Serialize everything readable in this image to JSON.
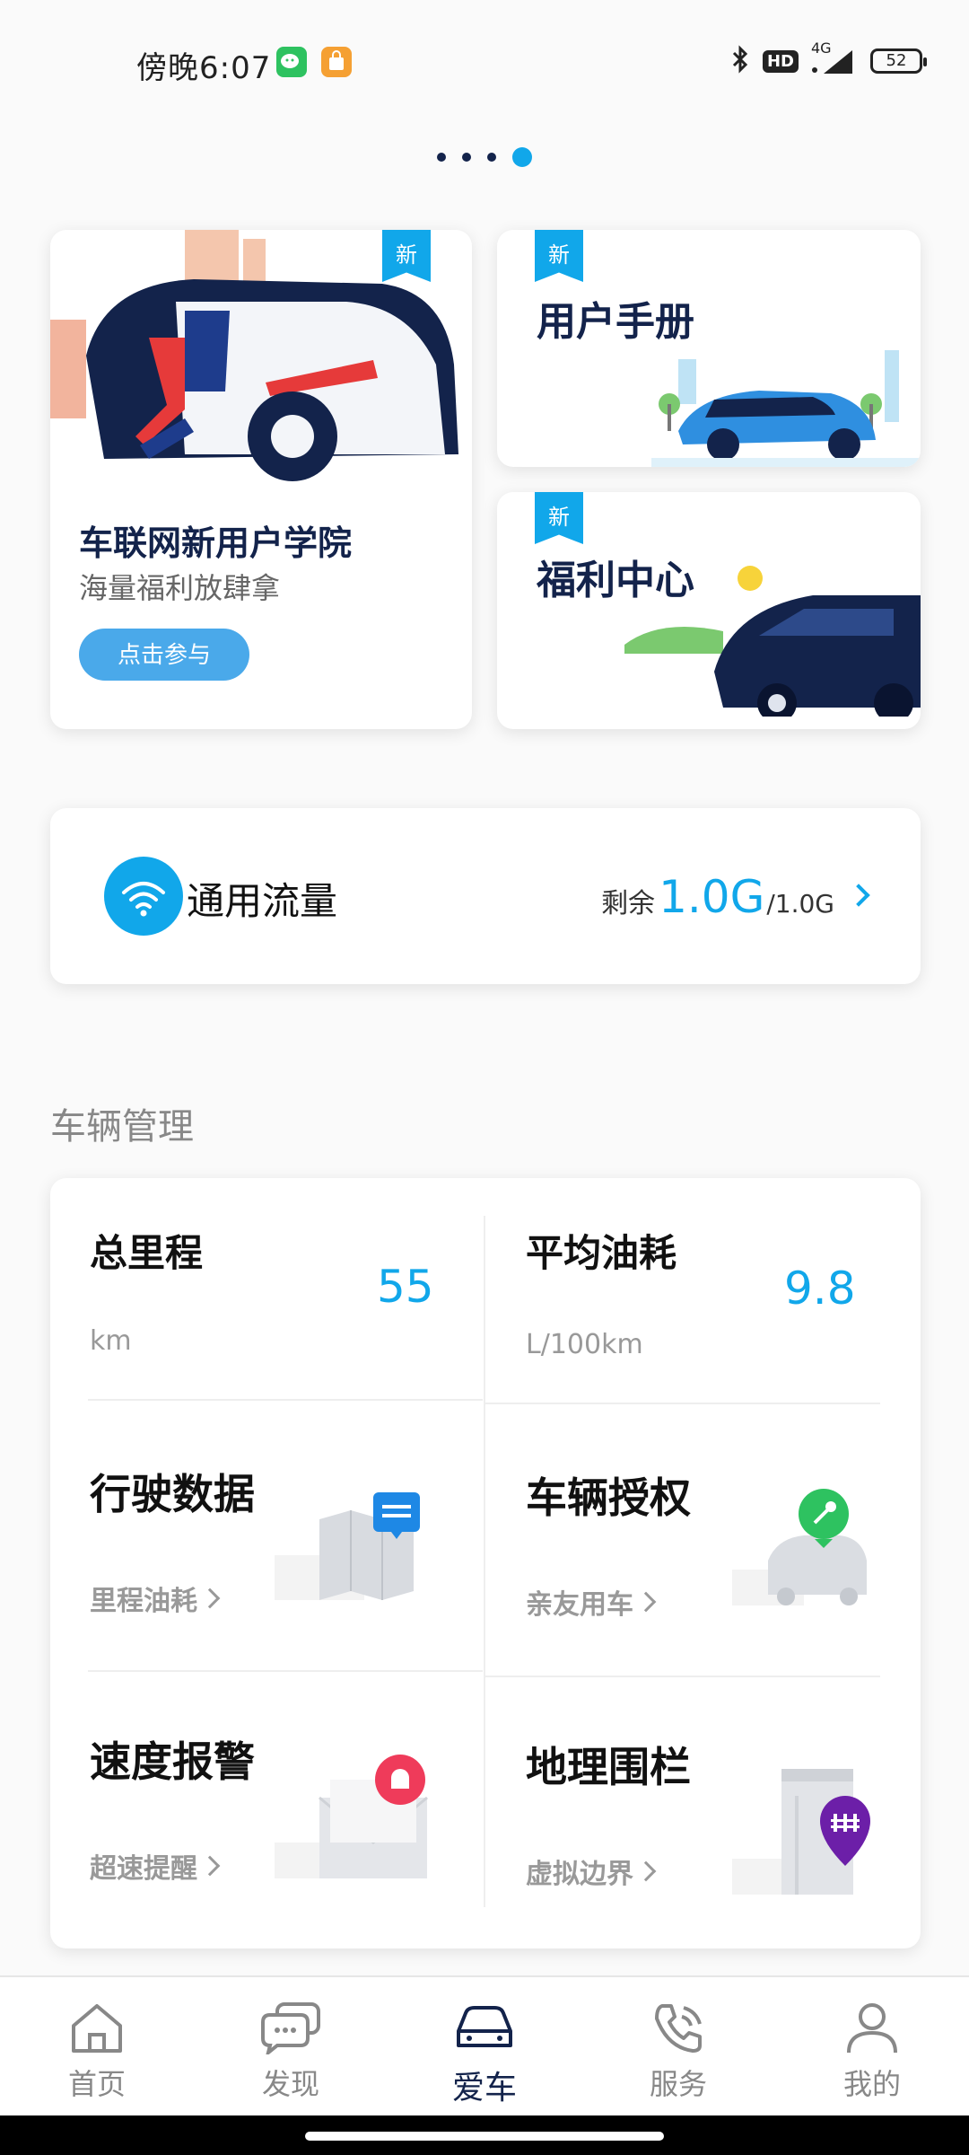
{
  "status_bar": {
    "time": "傍晚6:07",
    "network": "4G",
    "hd": "HD",
    "battery": "52"
  },
  "pager": {
    "total": 4,
    "active_index": 3
  },
  "banners": {
    "academy": {
      "badge": "新",
      "title": "车联网新用户学院",
      "subtitle": "海量福利放肆拿",
      "button": "点击参与"
    },
    "manual": {
      "badge": "新",
      "title": "用户手册"
    },
    "welfare": {
      "badge": "新",
      "title": "福利中心"
    }
  },
  "data_plan": {
    "label": "通用流量",
    "remain_label": "剩余",
    "remain_value": "1.0G",
    "total": "/1.0G"
  },
  "vehicle_management": {
    "section_title": "车辆管理",
    "mileage": {
      "title": "总里程",
      "value": "55",
      "unit": "km"
    },
    "fuel": {
      "title": "平均油耗",
      "value": "9.8",
      "unit": "L/100km"
    },
    "driving_data": {
      "title": "行驶数据",
      "link": "里程油耗"
    },
    "authorization": {
      "title": "车辆授权",
      "link": "亲友用车"
    },
    "speed_alert": {
      "title": "速度报警",
      "link": "超速提醒"
    },
    "geofence": {
      "title": "地理围栏",
      "link": "虚拟边界"
    }
  },
  "bottom_nav": {
    "items": [
      {
        "label": "首页",
        "icon": "home-icon"
      },
      {
        "label": "发现",
        "icon": "chat-icon"
      },
      {
        "label": "爱车",
        "icon": "car-icon"
      },
      {
        "label": "服务",
        "icon": "phone-icon"
      },
      {
        "label": "我的",
        "icon": "user-icon"
      }
    ],
    "active": "爱车"
  },
  "colors": {
    "accent": "#11a7ea",
    "navy": "#13234b",
    "background": "#fafafa"
  }
}
